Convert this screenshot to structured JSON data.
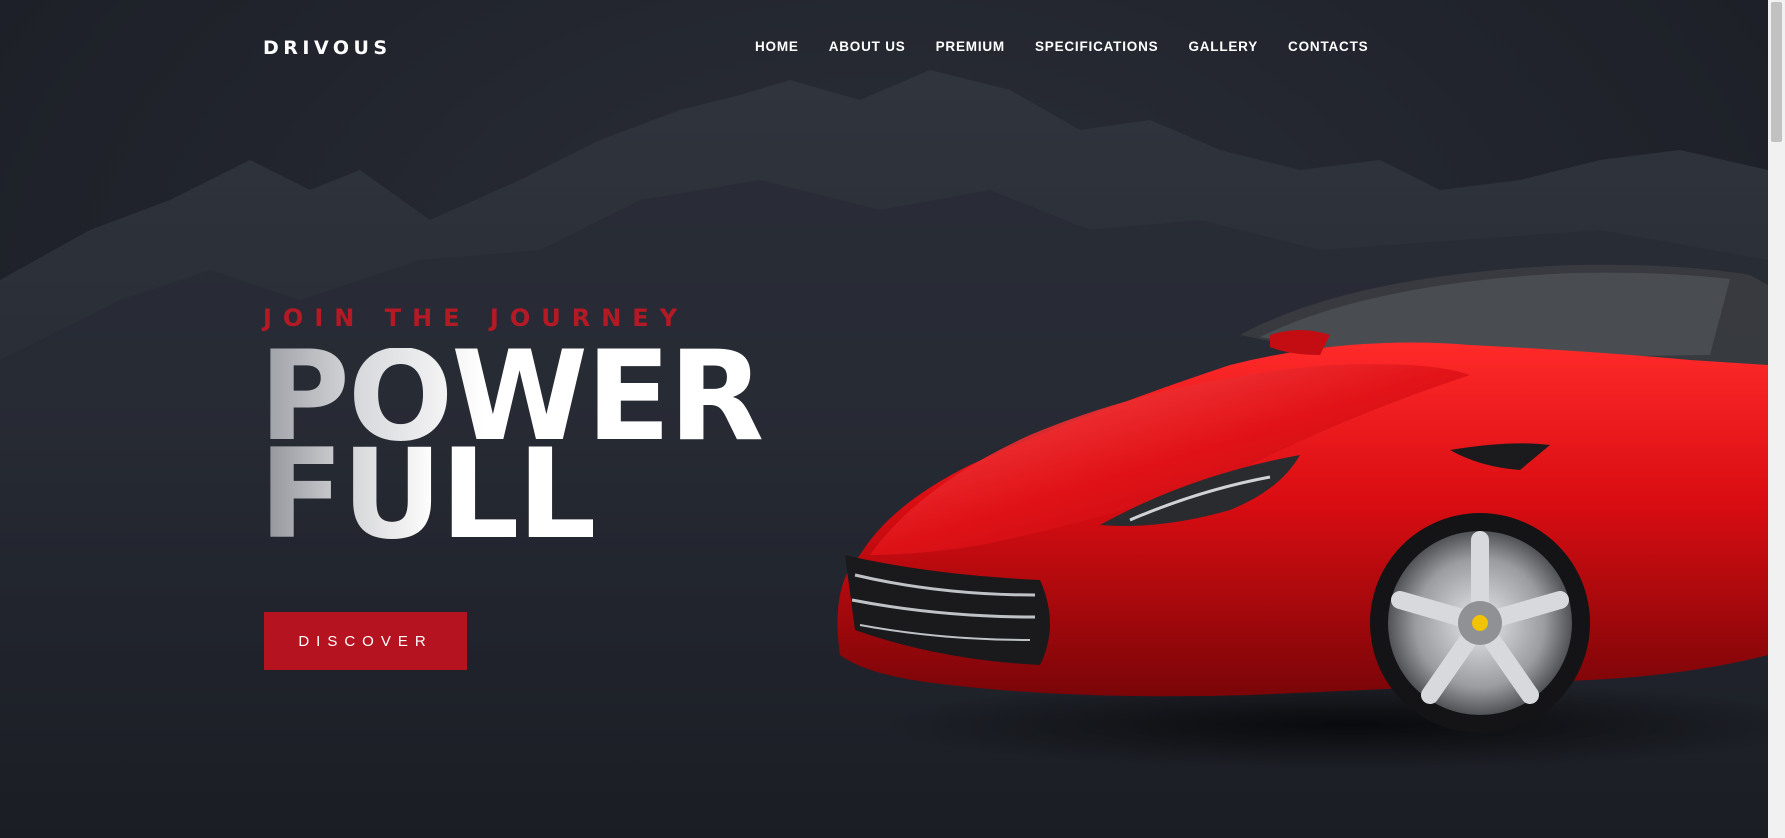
{
  "brand": {
    "logo_text": "DRIVOUS"
  },
  "nav": {
    "items": [
      {
        "label": "HOME"
      },
      {
        "label": "ABOUT US"
      },
      {
        "label": "PREMIUM"
      },
      {
        "label": "SPECIFICATIONS"
      },
      {
        "label": "GALLERY"
      },
      {
        "label": "CONTACTS"
      }
    ]
  },
  "hero": {
    "eyebrow": "JOIN THE JOURNEY",
    "headline_line1": "POWER",
    "headline_line2": "FULL",
    "cta_label": "DISCOVER",
    "image": "red-convertible-sports-car",
    "background": "dark-mountain-range"
  },
  "colors": {
    "accent": "#b5131f",
    "background": "#1e2129",
    "text": "#ffffff"
  }
}
